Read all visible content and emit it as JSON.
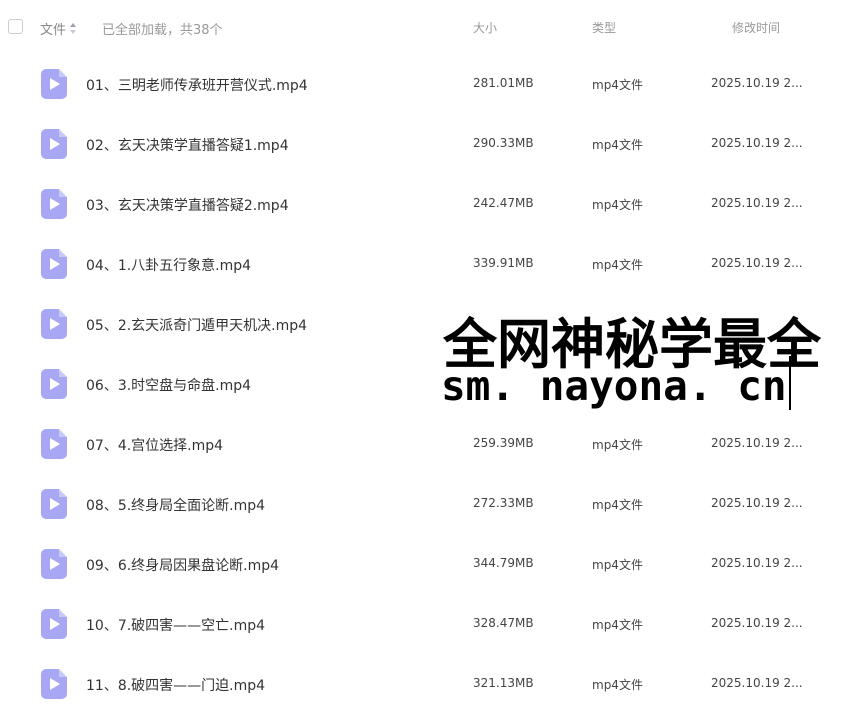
{
  "header": {
    "name_label": "文件",
    "status_text": "已全部加载，共38个",
    "size_label": "大小",
    "type_label": "类型",
    "time_label": "修改时间"
  },
  "files": [
    {
      "name": "01、三明老师传承班开营仪式.mp4",
      "size": "281.01MB",
      "type": "mp4文件",
      "time": "2025.10.19 2..."
    },
    {
      "name": "02、玄天决策学直播答疑1.mp4",
      "size": "290.33MB",
      "type": "mp4文件",
      "time": "2025.10.19 2..."
    },
    {
      "name": "03、玄天决策学直播答疑2.mp4",
      "size": "242.47MB",
      "type": "mp4文件",
      "time": "2025.10.19 2..."
    },
    {
      "name": "04、1.八卦五行象意.mp4",
      "size": "339.91MB",
      "type": "mp4文件",
      "time": "2025.10.19 2..."
    },
    {
      "name": "05、2.玄天派奇门遁甲天机决.mp4",
      "size": "",
      "type": "",
      "time": ""
    },
    {
      "name": "06、3.时空盘与命盘.mp4",
      "size": "",
      "type": "",
      "time": ""
    },
    {
      "name": "07、4.宫位选择.mp4",
      "size": "259.39MB",
      "type": "mp4文件",
      "time": "2025.10.19 2..."
    },
    {
      "name": "08、5.终身局全面论断.mp4",
      "size": "272.33MB",
      "type": "mp4文件",
      "time": "2025.10.19 2..."
    },
    {
      "name": "09、6.终身局因果盘论断.mp4",
      "size": "344.79MB",
      "type": "mp4文件",
      "time": "2025.10.19 2..."
    },
    {
      "name": "10、7.破四害——空亡.mp4",
      "size": "328.47MB",
      "type": "mp4文件",
      "time": "2025.10.19 2..."
    },
    {
      "name": "11、8.破四害——门迫.mp4",
      "size": "321.13MB",
      "type": "mp4文件",
      "time": "2025.10.19 2..."
    }
  ],
  "watermark": {
    "line1": "全网神秘学最全",
    "line2": "sm. nayona. cn"
  }
}
